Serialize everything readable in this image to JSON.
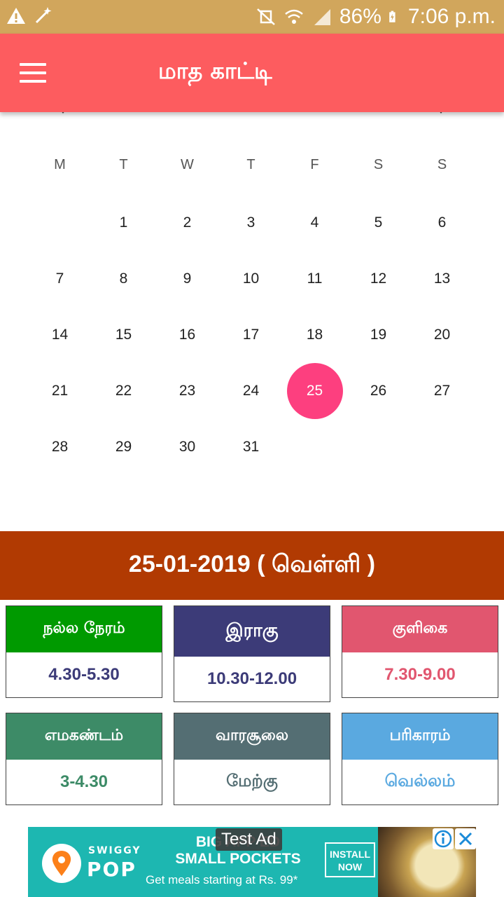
{
  "status_bar": {
    "battery": "86%",
    "time": "7:06 p.m.",
    "left_icons": [
      "warning-icon",
      "magic-wand-icon"
    ],
    "right_icons": [
      "mute-icon",
      "wifi-icon",
      "signal-icon",
      "battery-charging-icon"
    ]
  },
  "toolbar": {
    "title": "மாத காட்டி",
    "menu_icon": "hamburger-menu-icon",
    "color": "#fd5c5f"
  },
  "calendar": {
    "weekdays": [
      "M",
      "T",
      "W",
      "T",
      "F",
      "S",
      "S"
    ],
    "weeks": [
      [
        "",
        "1",
        "2",
        "3",
        "4",
        "5",
        "6"
      ],
      [
        "7",
        "8",
        "9",
        "10",
        "11",
        "12",
        "13"
      ],
      [
        "14",
        "15",
        "16",
        "17",
        "18",
        "19",
        "20"
      ],
      [
        "21",
        "22",
        "23",
        "24",
        "25",
        "26",
        "27"
      ],
      [
        "28",
        "29",
        "30",
        "31",
        "",
        "",
        ""
      ]
    ],
    "selected_day": "25",
    "selected_color": "#fd3f7f"
  },
  "date_banner": {
    "text": "25-01-2019 ( வெள்ளி )",
    "color": "#b13a02"
  },
  "cards": [
    {
      "title": "நல்ல நேரம்",
      "value": "4.30-5.30",
      "head_color": "#009a00",
      "value_color": "#3c3b78"
    },
    {
      "title": "இராகு",
      "value": "10.30-12.00",
      "head_color": "#3c3b78",
      "value_color": "#3c3b78"
    },
    {
      "title": "குளிகை",
      "value": "7.30-9.00",
      "head_color": "#e1566f",
      "value_color": "#e1566f"
    },
    {
      "title": "எமகண்டம்",
      "value": "3-4.30",
      "head_color": "#3d8b67",
      "value_color": "#3d8b67"
    },
    {
      "title": "வாரசூலை",
      "value": "மேற்கு",
      "head_color": "#546e73",
      "value_color": "#546e73"
    },
    {
      "title": "பரிகாரம்",
      "value": "வெல்லம்",
      "head_color": "#5aa9e0",
      "value_color": "#5aa9e0"
    }
  ],
  "ad": {
    "tag": "Test Ad",
    "brand_top": "SWIGGY",
    "brand": "POP",
    "headline": "BIG APP    ED\nSMALL POCKETS",
    "subtext": "Get meals starting at Rs. 99*",
    "install": "INSTALL\nNOW",
    "info_icon": "info-icon",
    "close_icon": "close-icon"
  }
}
